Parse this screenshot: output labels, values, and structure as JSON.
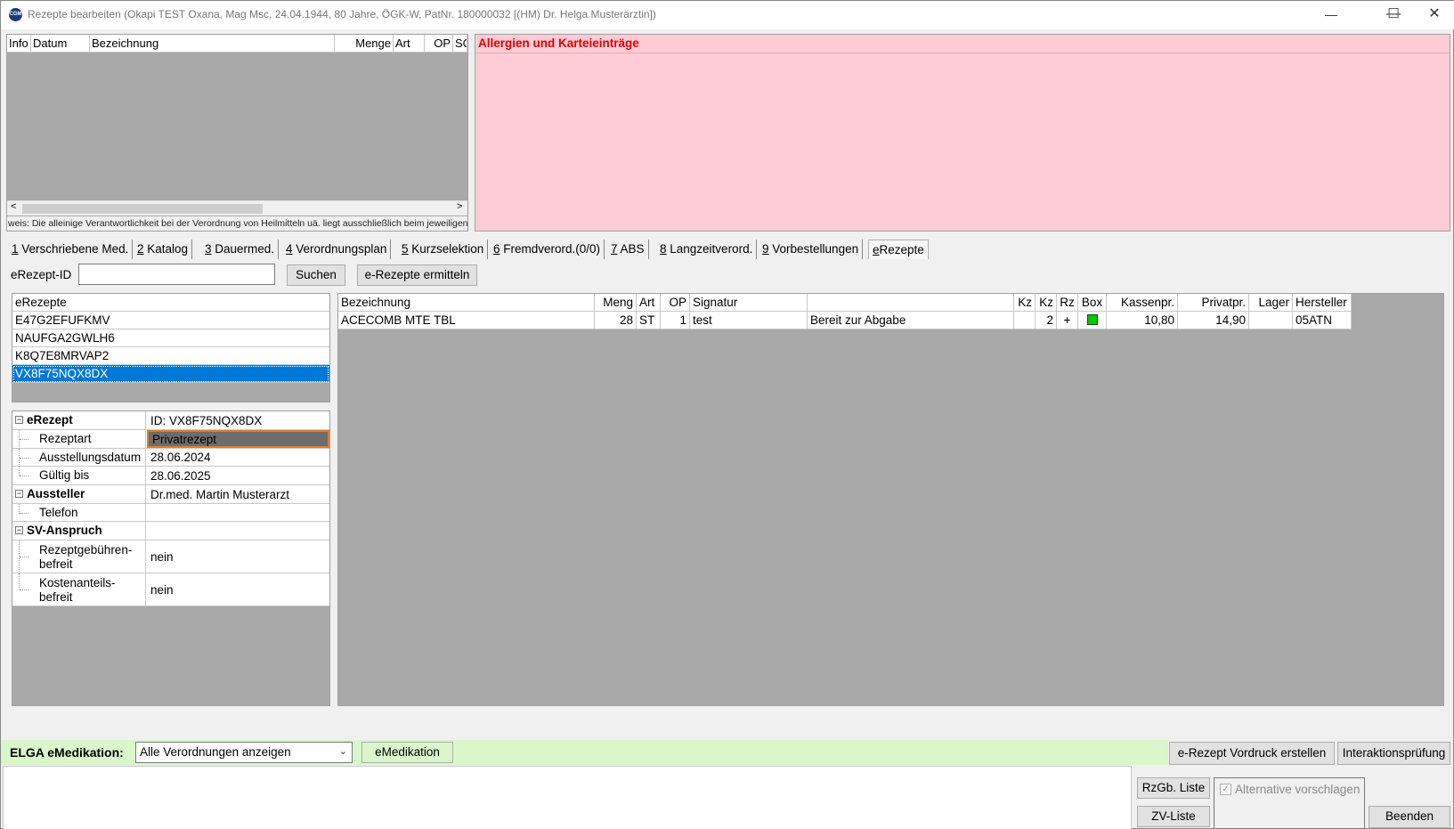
{
  "window": {
    "icon_text": "CGM",
    "title": "Rezepte bearbeiten (Okapi TEST Oxana, Mag Msc, 24.04.1944, 80 Jahre, ÖGK-W, PatNr. 180000032 [(HM) Dr. Helga Musterärztin])",
    "minimize": "—",
    "maximize": "☐",
    "close": "✕"
  },
  "top_list": {
    "headers": [
      "Info",
      "Datum",
      "Bezeichnung",
      "Menge",
      "Art",
      "OP",
      "SC"
    ],
    "scroll_left": "<",
    "scroll_right": ">",
    "note": "weis: Die alleinige Verantwortlichkeit bei der Verordnung von Heilmitteln uä. liegt ausschließlich beim jeweiligen"
  },
  "allergy": {
    "title": "Allergien und Karteieinträge"
  },
  "tabs": [
    {
      "key": "1",
      "label": " Verschriebene Med."
    },
    {
      "key": "2",
      "label": " Katalog"
    },
    {
      "key": "3",
      "label": " Dauermed."
    },
    {
      "key": "4",
      "label": " Verordnungsplan"
    },
    {
      "key": "5",
      "label": " Kurzselektion"
    },
    {
      "key": "6",
      "label": " Fremdverord.(0/0)"
    },
    {
      "key": "7",
      "label": " ABS"
    },
    {
      "key": "8",
      "label": " Langzeitverord."
    },
    {
      "key": "9",
      "label": " Vorbestellungen"
    },
    {
      "key": "e",
      "label": "Rezepte"
    }
  ],
  "search": {
    "label": "eRezept-ID",
    "value": "",
    "search_button": "Suchen",
    "fetch_button": "e-Rezepte ermitteln"
  },
  "erezepte_list": {
    "header": "eRezepte",
    "items": [
      "E47G2EFUFKMV",
      "NAUFGA2GWLH6",
      "K8Q7E8MRVAP2",
      "VX8F75NQX8DX"
    ],
    "selected_index": 3
  },
  "properties": {
    "cat1": {
      "label": "eRezept",
      "value": "ID: VX8F75NQX8DX",
      "expander": "⊟"
    },
    "rezeptart": {
      "label": "Rezeptart",
      "value": "Privatrezept"
    },
    "ausstellungsdatum": {
      "label": "Ausstellungsdatum",
      "value": "28.06.2024"
    },
    "gueltig": {
      "label": "Gültig bis",
      "value": "28.06.2025"
    },
    "cat2": {
      "label": "Aussteller",
      "value": "Dr.med. Martin Musterarzt",
      "expander": "⊟"
    },
    "telefon": {
      "label": "Telefon",
      "value": ""
    },
    "cat3": {
      "label": "SV-Anspruch",
      "value": "",
      "expander": "⊟"
    },
    "rezeptgebuehren": {
      "label1": "Rezeptgebühren-",
      "label2": "befreit",
      "value": "nein"
    },
    "kostenanteil": {
      "label1": "Kostenanteils-",
      "label2": "befreit",
      "value": "nein"
    }
  },
  "grid": {
    "headers": [
      "Bezeichnung",
      "Meng",
      "Art",
      "OP",
      "Signatur",
      "",
      "Kz",
      "Kz",
      "Rz",
      "Box",
      "Kassenpr.",
      "Privatpr.",
      "Lager",
      "Hersteller"
    ],
    "row": {
      "bezeichnung": "ACECOMB MTE TBL",
      "menge": "28",
      "art": "ST",
      "op": "1",
      "signatur": "test",
      "status": "Bereit zur Abgabe",
      "kz1": "",
      "kz2": "2",
      "rz": "+",
      "box_color": "#00c800",
      "kassenpr": "10,80",
      "privatpr": "14,90",
      "lager": "",
      "hersteller": "05ATN"
    }
  },
  "elga": {
    "label": "ELGA eMedikation:",
    "select_value": "Alle Verordnungen anzeigen",
    "emedikation_button": "eMedikation"
  },
  "actions": {
    "vordruck": "e-Rezept Vordruck erstellen",
    "interaktion": "Interaktionsprüfung",
    "rzgb_liste": "RzGb. Liste",
    "zv_liste": "ZV-Liste",
    "alternative": "Alternative vorschlagen",
    "beenden": "Beenden"
  }
}
